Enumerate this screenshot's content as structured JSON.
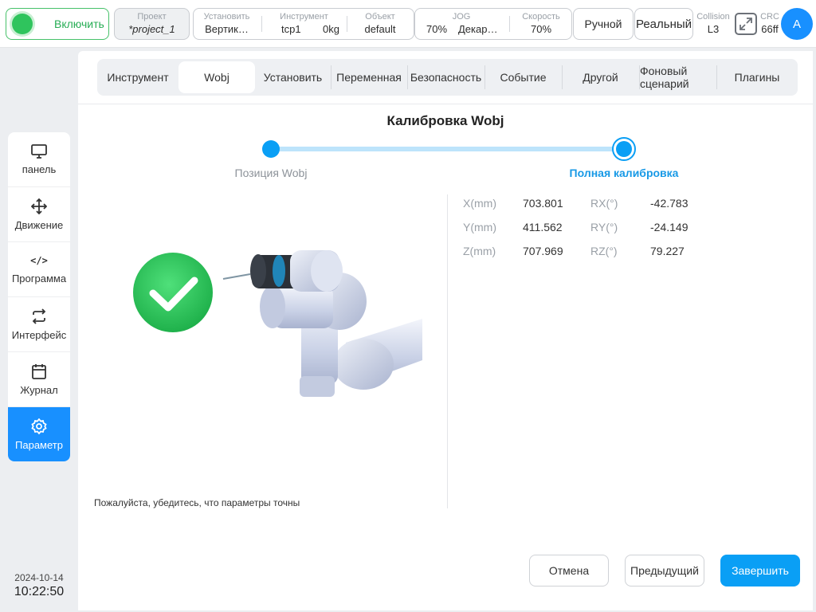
{
  "topbar": {
    "power_label": "Включить",
    "project": {
      "caption": "Проект",
      "value": "*project_1"
    },
    "install": {
      "caption": "Установить",
      "value": "Вертик…"
    },
    "tool": {
      "caption": "Инструмент",
      "name": "tcp1",
      "weight": "0kg"
    },
    "object": {
      "caption": "Объект",
      "value": "default"
    },
    "jog": {
      "caption": "JOG",
      "percent": "70%",
      "frame": "Декар…"
    },
    "speed": {
      "caption": "Скорость",
      "value": "70%"
    },
    "mode": "Ручной",
    "env": "Реальный",
    "collision": {
      "caption": "Collision",
      "value": "L3"
    },
    "crc": {
      "caption": "CRC",
      "value": "66ff"
    },
    "avatar": "A"
  },
  "sidebar": {
    "items": [
      {
        "label": "панель",
        "icon": "monitor-icon"
      },
      {
        "label": "Движение",
        "icon": "move-arrows-icon"
      },
      {
        "label": "Программа",
        "icon": "code-icon",
        "glyph": "</>"
      },
      {
        "label": "Интерфейс",
        "icon": "swap-icon"
      },
      {
        "label": "Журнал",
        "icon": "calendar-icon"
      },
      {
        "label": "Параметр",
        "icon": "gear-icon",
        "active": true
      }
    ],
    "date": "2024-10-14",
    "time": "10:22:50"
  },
  "tabs": [
    {
      "label": "Инструмент"
    },
    {
      "label": "Wobj",
      "active": true
    },
    {
      "label": "Установить"
    },
    {
      "label": "Переменная"
    },
    {
      "label": "Безопасность"
    },
    {
      "label": "Событие"
    },
    {
      "label": "Другой"
    },
    {
      "label": "Фоновый сценарий"
    },
    {
      "label": "Плагины"
    }
  ],
  "calibration": {
    "title": "Калибровка Wobj",
    "steps": [
      {
        "label": "Позиция Wobj"
      },
      {
        "label": "Полная калибровка",
        "active": true
      }
    ],
    "readout": [
      {
        "k1": "X(mm)",
        "v1": "703.801",
        "k2": "RX(°)",
        "v2": "-42.783"
      },
      {
        "k1": "Y(mm)",
        "v1": "411.562",
        "k2": "RY(°)",
        "v2": "-24.149"
      },
      {
        "k1": "Z(mm)",
        "v1": "707.969",
        "k2": "RZ(°)",
        "v2": "79.227"
      }
    ],
    "note": "Пожалуйста, убедитесь, что параметры точны"
  },
  "buttons": {
    "cancel": "Отмена",
    "previous": "Предыдущий",
    "finish": "Завершить"
  },
  "colors": {
    "accent": "#1890ff",
    "power_green": "#2fc45d",
    "step_blue": "#0a9ff5"
  }
}
